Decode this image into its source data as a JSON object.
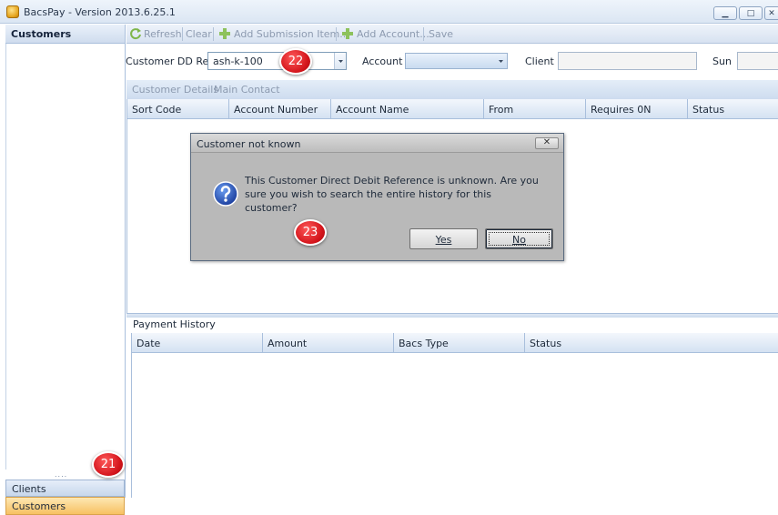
{
  "window": {
    "title": "BacsPay - Version 2013.6.25.1"
  },
  "window_controls": {
    "minimize": "▁",
    "maximize": "□",
    "close": "✕"
  },
  "sidebar": {
    "title": "Customers",
    "grip": "....",
    "nav": {
      "clients": "Clients",
      "customers": "Customers"
    }
  },
  "toolbar": {
    "refresh": "Refresh",
    "clear": "Clear",
    "add_submission": "Add Submission Item...",
    "add_account": "Add Account...",
    "save": "Save"
  },
  "filter": {
    "dd_ref_label": "Customer DD Ref",
    "dd_ref_value": "ash-k-100",
    "account_label": "Account",
    "client_label": "Client",
    "sun_label": "Sun"
  },
  "tabs": [
    "Customer Details",
    "Main Contact"
  ],
  "accounts_grid": {
    "columns": [
      "Sort Code",
      "Account Number",
      "Account Name",
      "From",
      "Requires 0N",
      "Status"
    ]
  },
  "payment_history": {
    "title": "Payment History",
    "columns": [
      "Date",
      "Amount",
      "Bacs Type",
      "Status"
    ]
  },
  "dialog": {
    "title": "Customer not known",
    "close": "✕",
    "message": "This Customer Direct Debit Reference is unknown. Are you sure you wish to search the entire history for this customer?",
    "yes": "Yes",
    "no": "No"
  },
  "callouts": {
    "c21": "21",
    "c22": "22",
    "c23": "23"
  },
  "colors": {
    "accent_orange": "#f7c162",
    "callout_red": "#d3141b",
    "header_blue": "#d4e2f2"
  }
}
